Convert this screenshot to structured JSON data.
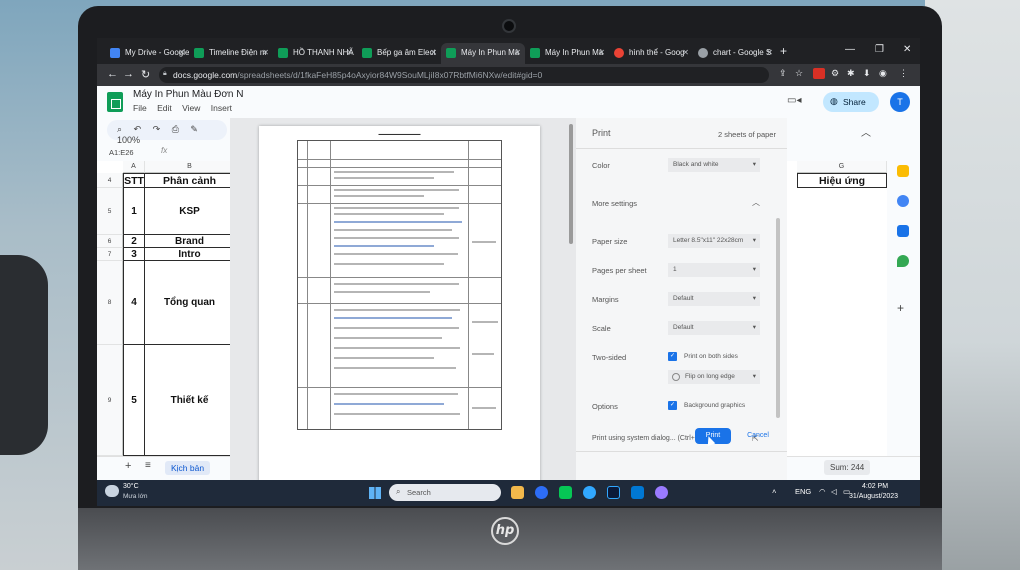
{
  "browser": {
    "tabs": [
      {
        "label": "My Drive - Google",
        "fav": "#4285f4"
      },
      {
        "label": "Timeline Điện m",
        "fav": "#0f9d58"
      },
      {
        "label": "HỒ THANH NHÃ",
        "fav": "#0f9d58"
      },
      {
        "label": "Bếp ga âm Elect",
        "fav": "#0f9d58"
      },
      {
        "label": "Máy In Phun Mà",
        "fav": "#0f9d58"
      },
      {
        "label": "Máy In Phun Mà",
        "fav": "#0f9d58"
      },
      {
        "label": "hình thể - Goog",
        "fav": "#ea4335"
      },
      {
        "label": "chart - Google S",
        "fav": "#9aa0a6"
      }
    ],
    "new_tab": "+",
    "url_host": "docs.google.com",
    "url_path": "/spreadsheets/d/1fkaFeH85p4oAxyior84W9SouMLjiI8x07RbtfMi6NXw/edit#gid=0"
  },
  "sheets": {
    "doc_title": "Máy In Phun Màu Đơn N",
    "menu": [
      "File",
      "Edit",
      "View",
      "Insert"
    ],
    "zoom": "100%",
    "share_label": "Share",
    "avatar_letter": "T",
    "name_box": "A1:E26",
    "fx": "fx",
    "columns": [
      "A",
      "B",
      "G"
    ],
    "header_row": {
      "row": "4",
      "stt": "STT",
      "phan_canh": "Phân cảnh",
      "hieu_ung": "Hiệu ứng"
    },
    "rows": [
      {
        "row": "5",
        "stt": "1",
        "name": "KSP"
      },
      {
        "row": "6",
        "stt": "2",
        "name": "Brand"
      },
      {
        "row": "7",
        "stt": "3",
        "name": "Intro"
      },
      {
        "row": "8",
        "stt": "4",
        "name": "Tổng quan"
      },
      {
        "row": "9",
        "stt": "5",
        "name": "Thiết kế"
      }
    ],
    "sheet_tab": "Kịch bản",
    "sum": "Sum: 244"
  },
  "print_dialog": {
    "title": "Print",
    "sheets_count": "2 sheets of paper",
    "color_label": "Color",
    "color_value": "Black and white",
    "more_settings": "More settings",
    "paper_size_label": "Paper size",
    "paper_size_value": "Letter 8.5\"x11\" 22x28cm",
    "pages_per_sheet_label": "Pages per sheet",
    "pages_per_sheet_value": "1",
    "margins_label": "Margins",
    "margins_value": "Default",
    "scale_label": "Scale",
    "scale_value": "Default",
    "two_sided_label": "Two-sided",
    "print_both_sides": "Print on both sides",
    "flip_value": "Flip on long edge",
    "options_label": "Options",
    "background_graphics": "Background graphics",
    "system_dialog": "Print using system dialog... (Ctrl+Shift+P)",
    "print_button": "Print",
    "cancel_button": "Cancel"
  },
  "taskbar": {
    "temp": "30°C",
    "weather": "Mưa lớn",
    "search_placeholder": "Search",
    "lang": "ENG",
    "time": "4:02 PM",
    "date": "31/August/2023"
  }
}
